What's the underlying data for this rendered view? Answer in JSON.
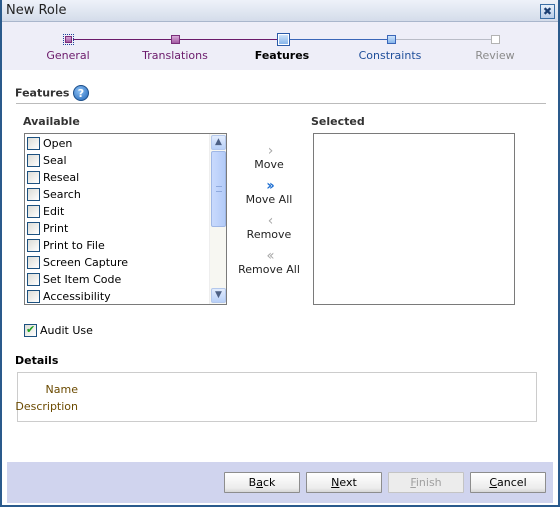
{
  "dialog": {
    "title": "New Role",
    "close_icon": "close-icon"
  },
  "train": {
    "steps": [
      {
        "label": "General",
        "state": "visited",
        "color": "#6b1a6b"
      },
      {
        "label": "Translations",
        "state": "visited",
        "color": "#6b1a6b"
      },
      {
        "label": "Features",
        "state": "current",
        "color": "#000000"
      },
      {
        "label": "Constraints",
        "state": "next",
        "color": "#1f4e9a"
      },
      {
        "label": "Review",
        "state": "disabled",
        "color": "#8a8a8a"
      }
    ]
  },
  "features": {
    "title": "Features",
    "help_icon": "?",
    "available_label": "Available",
    "selected_label": "Selected",
    "available_items": [
      {
        "label": "Open",
        "checked": false
      },
      {
        "label": "Seal",
        "checked": false
      },
      {
        "label": "Reseal",
        "checked": false
      },
      {
        "label": "Search",
        "checked": false
      },
      {
        "label": "Edit",
        "checked": false
      },
      {
        "label": "Print",
        "checked": false
      },
      {
        "label": "Print to File",
        "checked": false
      },
      {
        "label": "Screen Capture",
        "checked": false
      },
      {
        "label": "Set Item Code",
        "checked": false
      },
      {
        "label": "Accessibility",
        "checked": false
      }
    ],
    "selected_items": [],
    "shuttle": {
      "move": "Move",
      "move_all": "Move All",
      "remove": "Remove",
      "remove_all": "Remove All"
    },
    "audit_use": {
      "label": "Audit Use",
      "checked": true
    }
  },
  "details": {
    "title": "Details",
    "name_label": "Name",
    "description_label": "Description",
    "name_value": "",
    "description_value": ""
  },
  "footer": {
    "back": {
      "prefix": "B",
      "accel": "a",
      "suffix": "ck"
    },
    "next": {
      "prefix": "",
      "accel": "N",
      "suffix": "ext"
    },
    "finish": {
      "prefix": "",
      "accel": "F",
      "suffix": "inish",
      "disabled": true
    },
    "cancel": {
      "prefix": "",
      "accel": "C",
      "suffix": "ancel"
    }
  }
}
